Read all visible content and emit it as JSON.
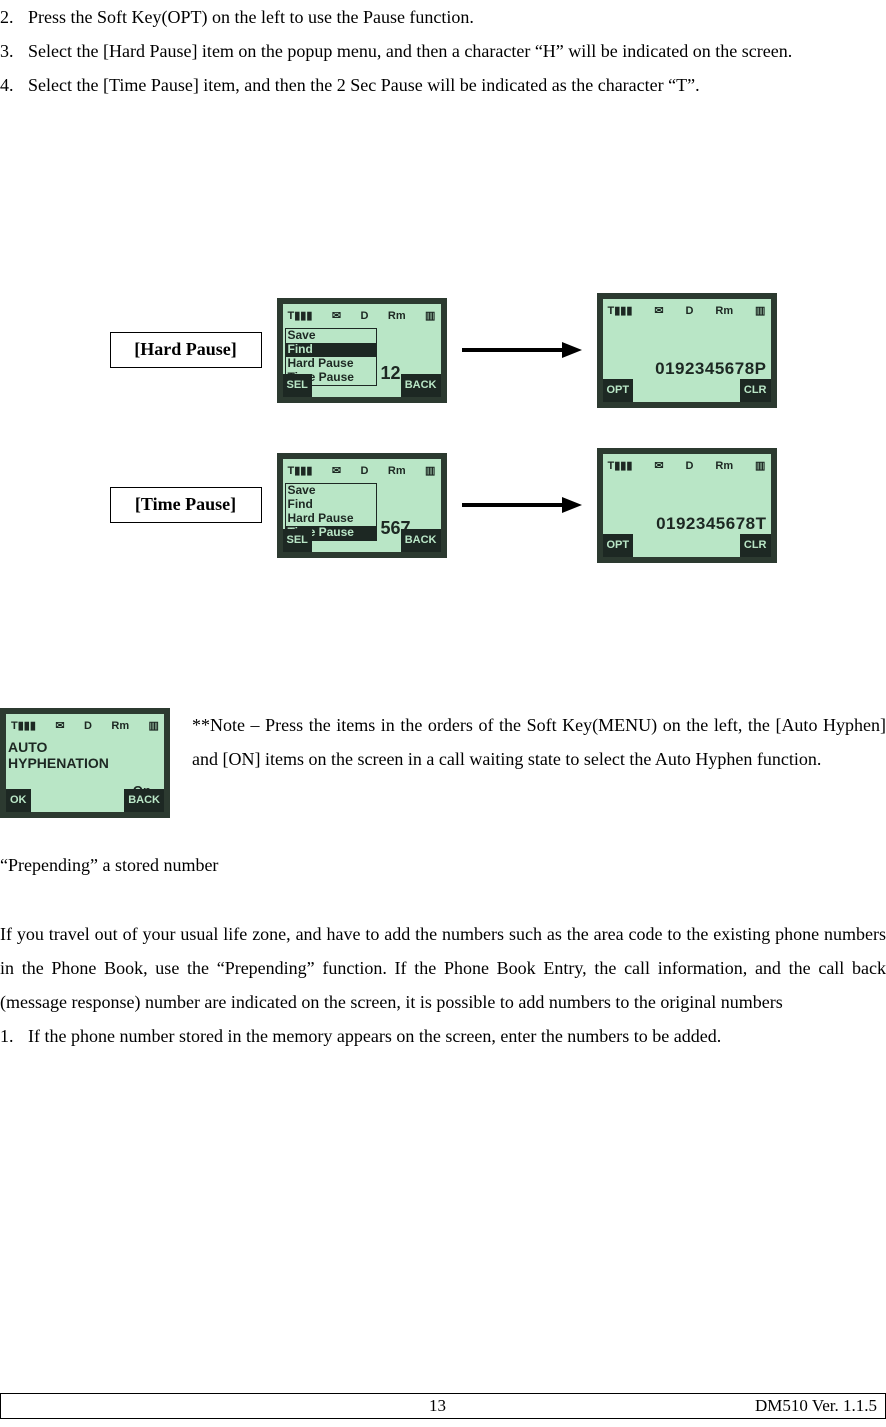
{
  "list": {
    "item2": {
      "num": "2.",
      "text": "Press the Soft Key(OPT) on the left to use the Pause function."
    },
    "item3": {
      "num": "3.",
      "text": "Select the [Hard Pause] item on the popup menu, and then a character “H” will be indicated on the screen."
    },
    "item4": {
      "num": "4.",
      "text": "Select the [Time Pause] item, and then the 2 Sec Pause will be indicated as the character “T”."
    }
  },
  "figures": {
    "hard": {
      "label": "[Hard Pause]",
      "menu": [
        "Save",
        "Find",
        "Hard Pause",
        "Time Pause"
      ],
      "selected": "Find",
      "side": "12",
      "sk_left": "SEL",
      "sk_right": "BACK",
      "result": "0192345678P",
      "res_sk_left": "OPT",
      "res_sk_right": "CLR"
    },
    "time": {
      "label": "[Time Pause]",
      "menu": [
        "Save",
        "Find",
        "Hard Pause",
        "Time Pause"
      ],
      "selected": "Time Pause",
      "side": "567",
      "sk_left": "SEL",
      "sk_right": "BACK",
      "result": "0192345678T",
      "res_sk_left": "OPT",
      "res_sk_right": "CLR"
    },
    "autohyph": {
      "line1": "AUTO",
      "line2": "HYPHENATION",
      "on": "On",
      "sk_left": "OK",
      "sk_right": "BACK"
    },
    "status": {
      "sig": "Tₙₗₗ",
      "msg": "✉",
      "d": "D",
      "rm": "Rm",
      "bat": "■■■"
    }
  },
  "note": "**Note – Press the items in the orders of the Soft Key(MENU) on the left, the [Auto Hyphen] and [ON] items on the screen in a call waiting state to select the Auto Hyphen function.",
  "subhead": "“Prepending” a stored number",
  "para": "If you travel out of your usual life zone, and have to add the numbers such as the area code to the existing phone numbers in the Phone Book, use the “Prepending” function. If the Phone Book Entry, the call information, and the call back (message response) number are indicated on the screen, it is possible to add numbers to the original numbers",
  "last": {
    "num": "1.",
    "text": "If the phone number stored in the memory appears on the screen, enter the numbers to be added."
  },
  "footer": {
    "page": "13",
    "ver": "DM510    Ver. 1.1.5"
  }
}
